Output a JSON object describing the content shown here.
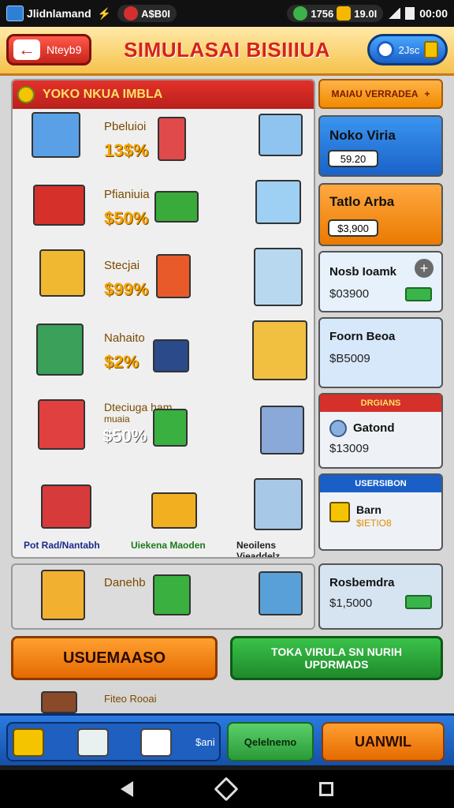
{
  "status_bar": {
    "app_name": "Jlidnlamand",
    "pill_red": "A$B0I",
    "pill_green_a": "1756",
    "pill_green_b": "19.0I",
    "time": "00:00"
  },
  "header": {
    "back_label": "Nteyb9",
    "title": "SIMULASAI BISIIIUA",
    "coins": "2Jsc"
  },
  "catalog": {
    "heading": "YOKO NKUA IMBLA",
    "items": [
      {
        "label": "Pbeluioi",
        "price": "13$%"
      },
      {
        "label": "Pfianiuia",
        "price": "$50%"
      },
      {
        "label": "Stecjai",
        "price": "$99%"
      },
      {
        "label": "Nahaito",
        "price": "$2%"
      },
      {
        "label": "Dteciuga ham",
        "sub": "muaia",
        "price": "$50%"
      }
    ],
    "bottom_labels": [
      "Pot Rad/Nantabh",
      "Uiekena Maoden",
      "Neoilens Vieaddelz"
    ]
  },
  "right_panel": {
    "add_button": "MAIAU VERRADEA",
    "cards": [
      {
        "title": "Noko Viria",
        "value": "59.20",
        "color": "#1f7fe0"
      },
      {
        "title": "Tatlo Arba",
        "value": "$3,900",
        "color": "#f28c1a"
      },
      {
        "title": "Nosb Ioamk",
        "value": "$03900",
        "color": "#dcecfb"
      },
      {
        "title": "Foorn Beoa",
        "value": "$B5009",
        "color": "#cfe5fa"
      },
      {
        "header": "DRGIANS",
        "title": "Gatond",
        "value": "$13009"
      },
      {
        "header": "USERSIBON",
        "title": "Barn",
        "value": "$IETIO8"
      }
    ]
  },
  "row2": {
    "label": "Danehb",
    "card_title": "Rosbemdra",
    "card_value": "$1,5000"
  },
  "actions": {
    "left_button": "USUEMAASO",
    "right_button_line1": "TOKA VIRULA SN NURIH",
    "right_button_line2": "UPDRMADS"
  },
  "under_actions": {
    "label": "Fiteo Rooai"
  },
  "toolbar": {
    "left_text": "$ani",
    "green_button": "Qelelnemo",
    "orange_button": "UANWIL"
  }
}
